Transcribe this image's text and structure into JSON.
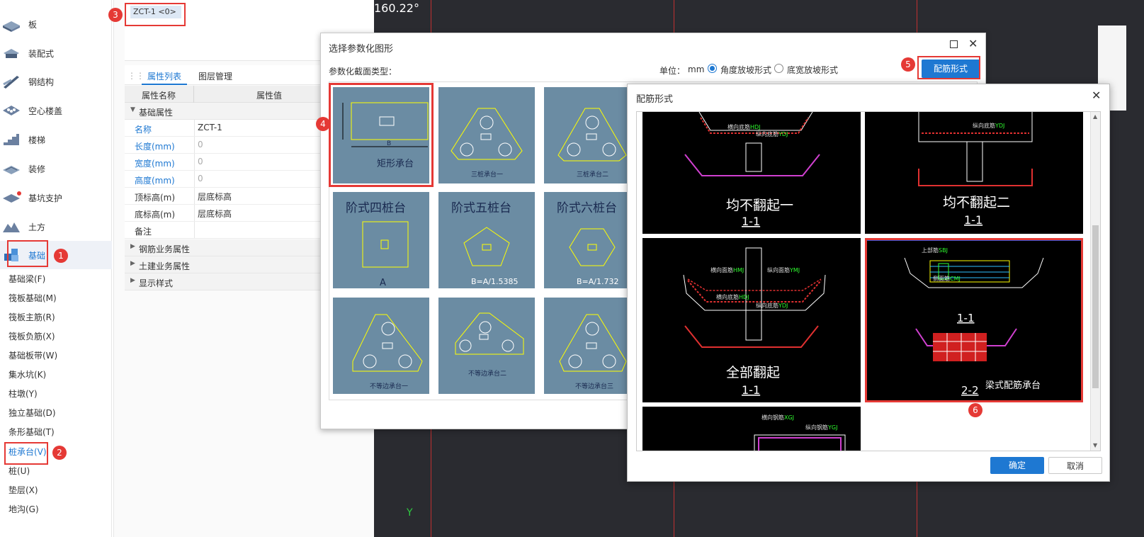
{
  "sidebar": {
    "items": [
      {
        "label": "板"
      },
      {
        "label": "装配式"
      },
      {
        "label": "钢结构"
      },
      {
        "label": "空心楼盖"
      },
      {
        "label": "楼梯"
      },
      {
        "label": "装修"
      },
      {
        "label": "基坑支护"
      },
      {
        "label": "土方"
      },
      {
        "label": "基础"
      }
    ],
    "sub_items": [
      {
        "label": "基础梁(F)"
      },
      {
        "label": "筏板基础(M)"
      },
      {
        "label": "筏板主筋(R)"
      },
      {
        "label": "筏板负筋(X)"
      },
      {
        "label": "基础板带(W)"
      },
      {
        "label": "集水坑(K)"
      },
      {
        "label": "柱墩(Y)"
      },
      {
        "label": "独立基础(D)"
      },
      {
        "label": "条形基础(T)"
      },
      {
        "label": "桩承台(V)"
      },
      {
        "label": "桩(U)"
      },
      {
        "label": "垫层(X)"
      },
      {
        "label": "地沟(G)"
      }
    ]
  },
  "component_list": {
    "selected": "ZCT-1 <0>"
  },
  "property_panel": {
    "tabs": [
      {
        "label": "属性列表"
      },
      {
        "label": "图层管理"
      }
    ],
    "col_name": "属性名称",
    "col_value": "属性值",
    "group_basic": "基础属性",
    "rows": [
      {
        "name": "名称",
        "value": "ZCT-1"
      },
      {
        "name": "长度(mm)",
        "value": "0"
      },
      {
        "name": "宽度(mm)",
        "value": "0"
      },
      {
        "name": "高度(mm)",
        "value": "0"
      },
      {
        "name": "顶标高(m)",
        "value": "层底标高"
      },
      {
        "name": "底标高(m)",
        "value": "层底标高"
      },
      {
        "name": "备注",
        "value": ""
      }
    ],
    "groups": [
      {
        "label": "钢筋业务属性"
      },
      {
        "label": "土建业务属性"
      },
      {
        "label": "显示样式"
      }
    ]
  },
  "canvas": {
    "angle": "160.22°"
  },
  "dialog_shape": {
    "title": "选择参数化图形",
    "section_label": "参数化截面类型：",
    "unit_label": "单位：",
    "unit_value": "mm",
    "radio_angle": "角度放坡形式",
    "radio_width": "底宽放坡形式",
    "rebar_button": "配筋形式",
    "tiles": [
      {
        "label": "矩形承台",
        "sub": "B"
      },
      {
        "label": "三桩承台一"
      },
      {
        "label": "三桩承台二"
      },
      {
        "label": "阶式四桩台",
        "sub": "A"
      },
      {
        "label": "阶式五桩台",
        "sub": "B=A/1.5385"
      },
      {
        "label": "阶式六桩台",
        "sub": "B=A/1.732"
      },
      {
        "label": "不等边承台一"
      },
      {
        "label": "不等边承台二"
      },
      {
        "label": "不等边承台三"
      }
    ]
  },
  "dialog_rebar": {
    "title": "配筋形式",
    "options": [
      {
        "label": "均不翻起一",
        "section": "1-1"
      },
      {
        "label": "均不翻起二",
        "section": "1-1"
      },
      {
        "label": "全部翻起",
        "section": "1-1"
      },
      {
        "label": "梁式配筋承台",
        "section": "2-2",
        "section_top": "1-1"
      }
    ],
    "ok": "确定",
    "cancel": "取消"
  },
  "annotations": {
    "n1": "1",
    "n2": "2",
    "n3": "3",
    "n4": "4",
    "n5": "5",
    "n6": "6"
  },
  "colors": {
    "accent": "#1e78d2",
    "highlight": "#e53935",
    "tile_bg": "#6b8ca3",
    "cad_bg": "#000000"
  }
}
